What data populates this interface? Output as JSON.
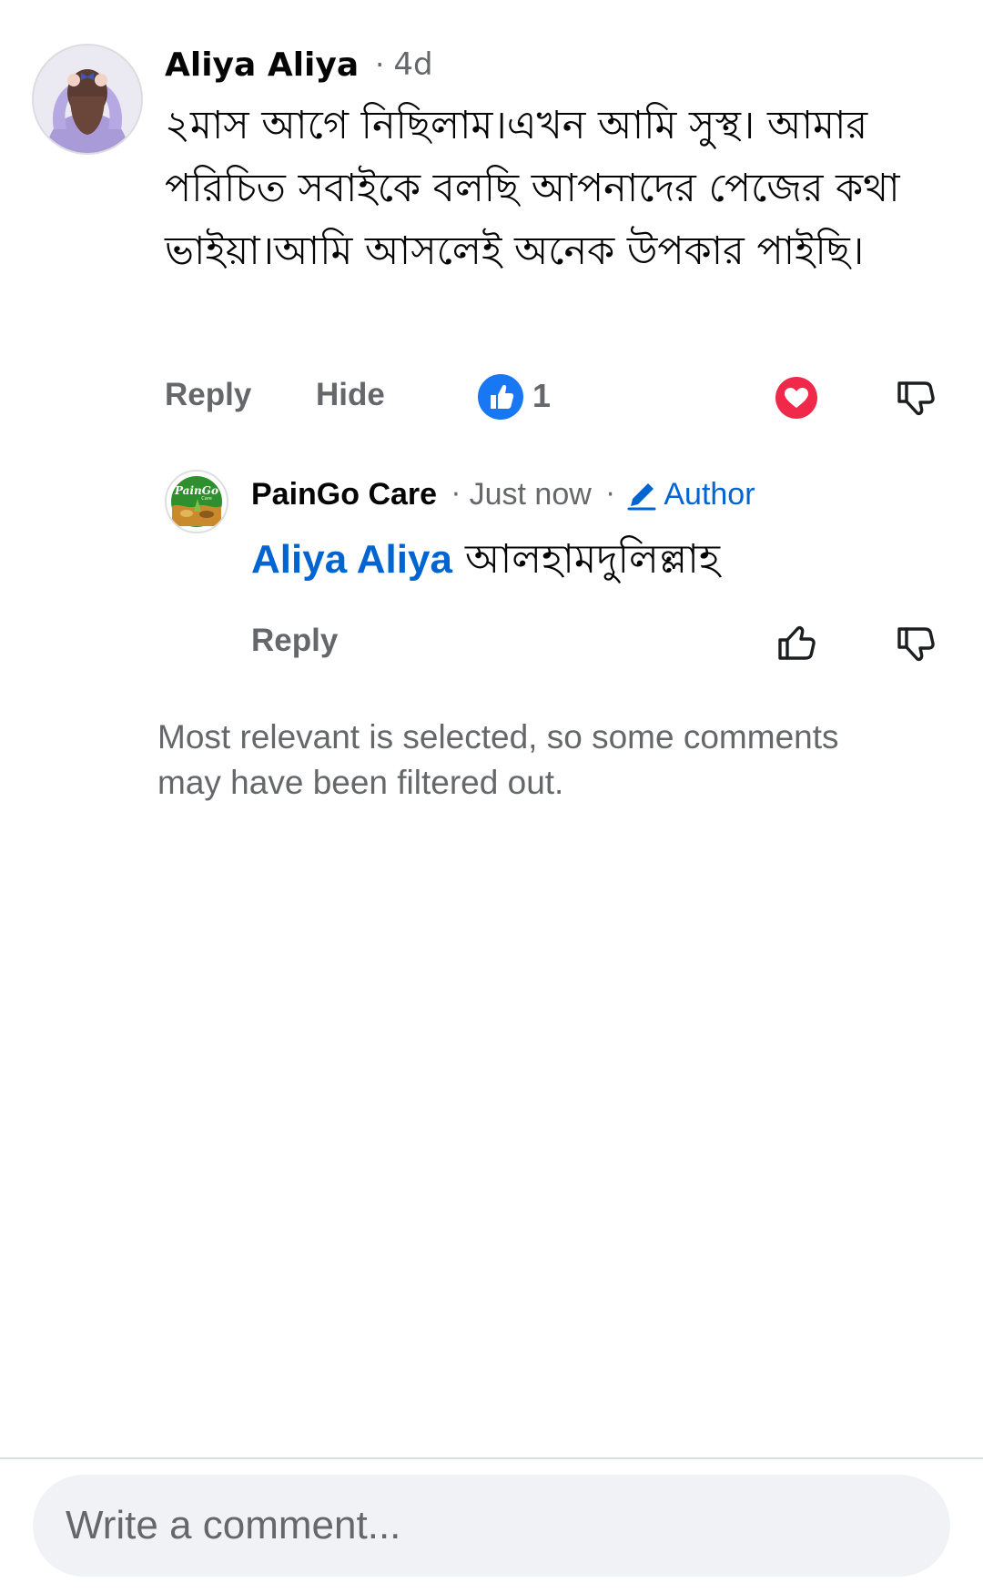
{
  "comment": {
    "author": "Aliya Aliya",
    "separator": "·",
    "time": "4d",
    "text": "২মাস আগে নিছিলাম।এখন আমি সুস্থ। আমার পরিচিত সবাইকে বলছি আপনাদের পেজের কথা ভাইয়া।আমি আসলেই অনেক উপকার পাইছি।",
    "actions": {
      "reply_label": "Reply",
      "hide_label": "Hide"
    },
    "reaction_count": "1",
    "avatar_icon": "user-avatar-photo",
    "reaction_icons": [
      "like-reaction-icon",
      "heart-icon",
      "thumbs-down-icon"
    ]
  },
  "reply": {
    "author": "PainGo Care",
    "separator": "·",
    "time": "Just now",
    "separator2": "·",
    "badge": "Author",
    "mention": "Aliya Aliya",
    "text": "আলহামদুলিল্লাহ",
    "reply_label": "Reply",
    "avatar_logo_text": "PainGo",
    "avatar_logo_subtext": "Care"
  },
  "filter_note": "Most relevant is selected, so some comments may have been filtered out.",
  "composer": {
    "placeholder": "Write a comment..."
  },
  "colors": {
    "link_blue": "#0064d1",
    "like_blue": "#1877f2",
    "heart_red": "#f02849",
    "secondary_text": "#65676b",
    "composer_bg": "#f0f2f5"
  }
}
